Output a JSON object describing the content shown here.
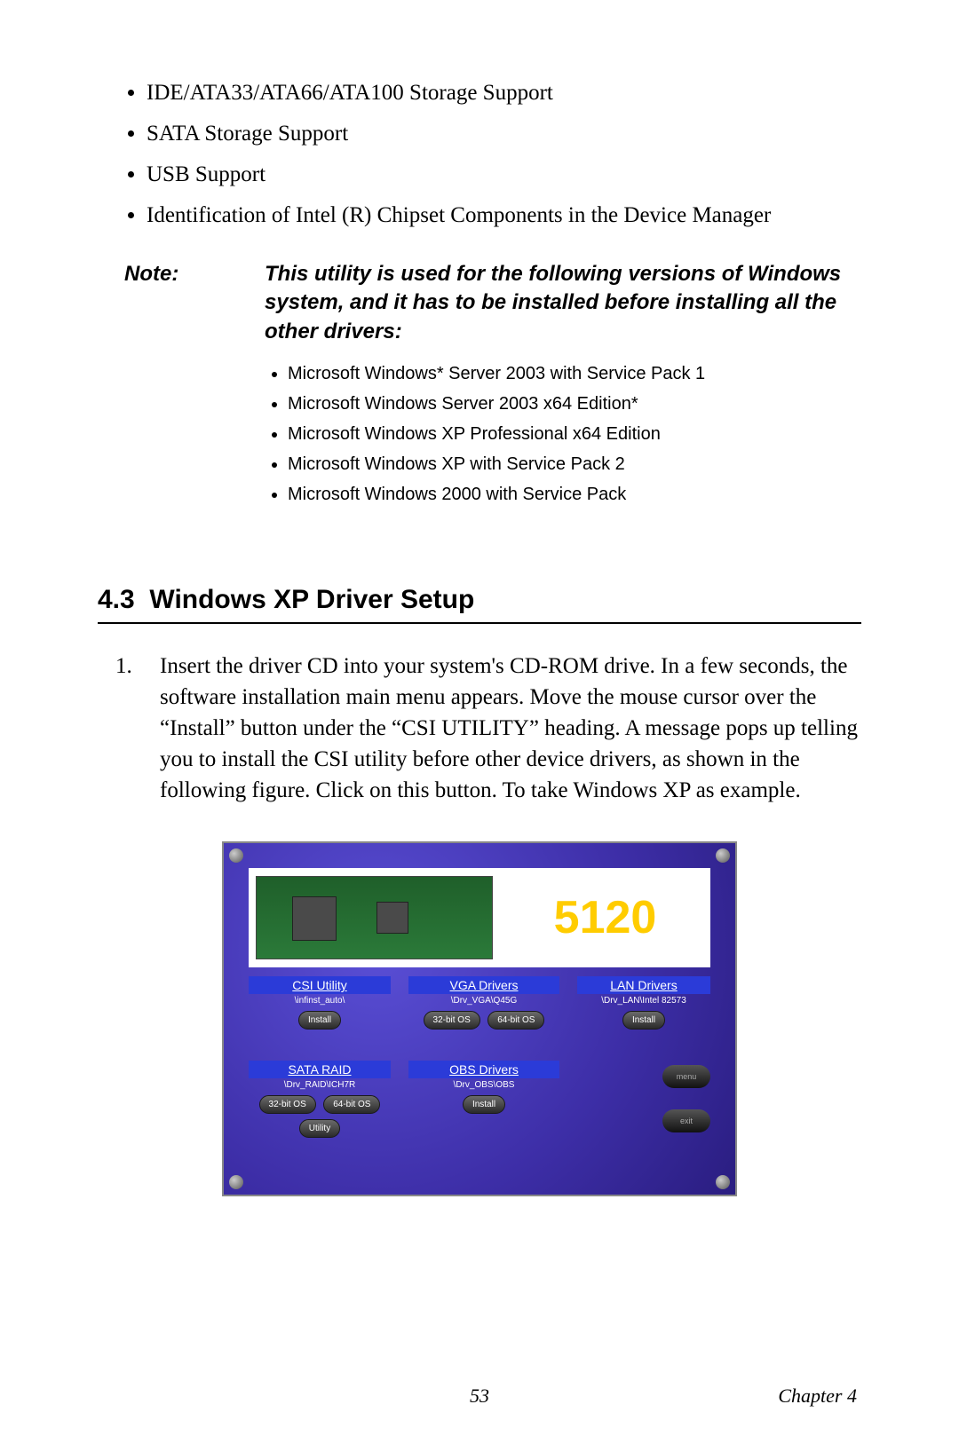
{
  "bullets": [
    "IDE/ATA33/ATA66/ATA100 Storage Support",
    "SATA Storage Support",
    "USB Support",
    "Identification of Intel (R) Chipset Components in the Device Manager"
  ],
  "note": {
    "label": "Note:",
    "body": "This utility is used for the following versions of Windows system, and it has to be installed before installing all the other drivers:",
    "items": [
      "Microsoft Windows* Server 2003 with Service Pack 1",
      "Microsoft Windows Server 2003 x64 Edition*",
      "Microsoft Windows XP Professional x64 Edition",
      "Microsoft Windows XP with Service Pack 2",
      "Microsoft Windows 2000 with Service Pack"
    ]
  },
  "section": {
    "number": "4.3",
    "title": "Windows XP Driver Setup"
  },
  "step": {
    "num": "1.",
    "text": "Insert the driver CD into your system's CD-ROM drive. In a few seconds, the software installation main menu appears. Move the mouse cursor over the “Install” button under the “CSI UTILITY” heading. A message pops up telling you to install the CSI utility before other device drivers, as shown in the following figure. Click on this button. To take Windows XP as example."
  },
  "installer": {
    "product": "5120",
    "sections": {
      "csi": {
        "title": "CSI Utility",
        "path": "\\infinst_auto\\",
        "buttons": [
          "Install"
        ],
        "extra": [
          "Utility"
        ]
      },
      "vga": {
        "title": "VGA Drivers",
        "path": "\\Drv_VGA\\Q45G",
        "buttons": [
          "32-bit OS",
          "64-bit OS"
        ]
      },
      "lan": {
        "title": "LAN Drivers",
        "path": "\\Drv_LAN\\Intel 82573",
        "buttons": [
          "Install"
        ]
      },
      "sata": {
        "title": "SATA RAID",
        "path": "\\Drv_RAID\\ICH7R",
        "buttons": [
          "32-bit OS",
          "64-bit OS"
        ]
      },
      "obs": {
        "title": "OBS Drivers",
        "path": "\\Drv_OBS\\OBS",
        "buttons": [
          "Install"
        ]
      }
    },
    "side": {
      "top": "menu",
      "bottom": "exit"
    }
  },
  "footer": {
    "page": "53",
    "chapter": "Chapter 4"
  }
}
